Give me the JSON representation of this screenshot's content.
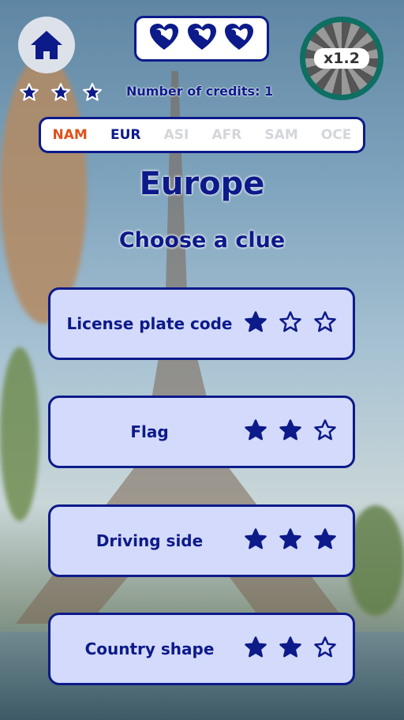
{
  "header": {
    "home_icon": "home-icon",
    "lives": 3,
    "multiplier": "x1.2",
    "stars_earned": 3,
    "credits_text": "Number of credits: 1"
  },
  "regions": [
    {
      "label": "NAM",
      "color": "#e0501a"
    },
    {
      "label": "EUR",
      "color": "#0c1a8a"
    },
    {
      "label": "ASI",
      "color": "#d3d6da"
    },
    {
      "label": "AFR",
      "color": "#d3d6da"
    },
    {
      "label": "SAM",
      "color": "#d3d6da"
    },
    {
      "label": "OCE",
      "color": "#d3d6da"
    }
  ],
  "main": {
    "title": "Europe",
    "subtitle": "Choose a clue"
  },
  "clues": [
    {
      "label": "License plate code",
      "difficulty": 1
    },
    {
      "label": "Flag",
      "difficulty": 2
    },
    {
      "label": "Driving side",
      "difficulty": 3
    },
    {
      "label": "Country shape",
      "difficulty": 2
    }
  ]
}
